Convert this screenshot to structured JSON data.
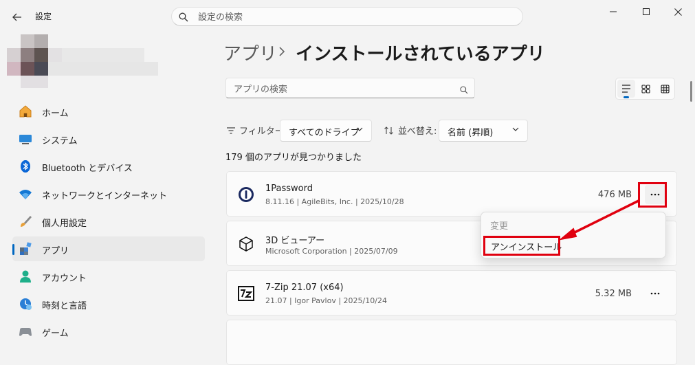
{
  "window": {
    "title": "設定",
    "search_placeholder": "設定の検索"
  },
  "sidebar": {
    "items": [
      {
        "label": "ホーム",
        "icon": "home-icon"
      },
      {
        "label": "システム",
        "icon": "system-icon"
      },
      {
        "label": "Bluetooth とデバイス",
        "icon": "bluetooth-icon"
      },
      {
        "label": "ネットワークとインターネット",
        "icon": "wifi-icon"
      },
      {
        "label": "個人用設定",
        "icon": "brush-icon"
      },
      {
        "label": "アプリ",
        "icon": "apps-icon",
        "selected": true
      },
      {
        "label": "アカウント",
        "icon": "account-icon"
      },
      {
        "label": "時刻と言語",
        "icon": "time-language-icon"
      },
      {
        "label": "ゲーム",
        "icon": "gaming-icon"
      }
    ]
  },
  "breadcrumb": {
    "parent": "アプリ",
    "separator": "›",
    "current": "インストールされているアプリ"
  },
  "app_search": {
    "placeholder": "アプリの検索"
  },
  "filters": {
    "filter_label": "フィルター:",
    "filter_value": "すべてのドライブ",
    "sort_label": "並べ替え:",
    "sort_value": "名前 (昇順)"
  },
  "result_count": "179 個のアプリが見つかりました",
  "apps": [
    {
      "name": "1Password",
      "meta": "8.11.16  |  AgileBits, Inc.  |  2025/10/28",
      "size": "476 MB"
    },
    {
      "name": "3D ビューアー",
      "meta": "Microsoft Corporation  |  2025/07/09",
      "size": ""
    },
    {
      "name": "7-Zip 21.07 (x64)",
      "meta": "21.07  |  Igor Pavlov  |  2025/10/24",
      "size": "5.32 MB"
    }
  ],
  "context_menu": {
    "modify": "変更",
    "uninstall": "アンインストール"
  },
  "colors": {
    "accent": "#0067c0",
    "highlight": "#e0000f"
  }
}
